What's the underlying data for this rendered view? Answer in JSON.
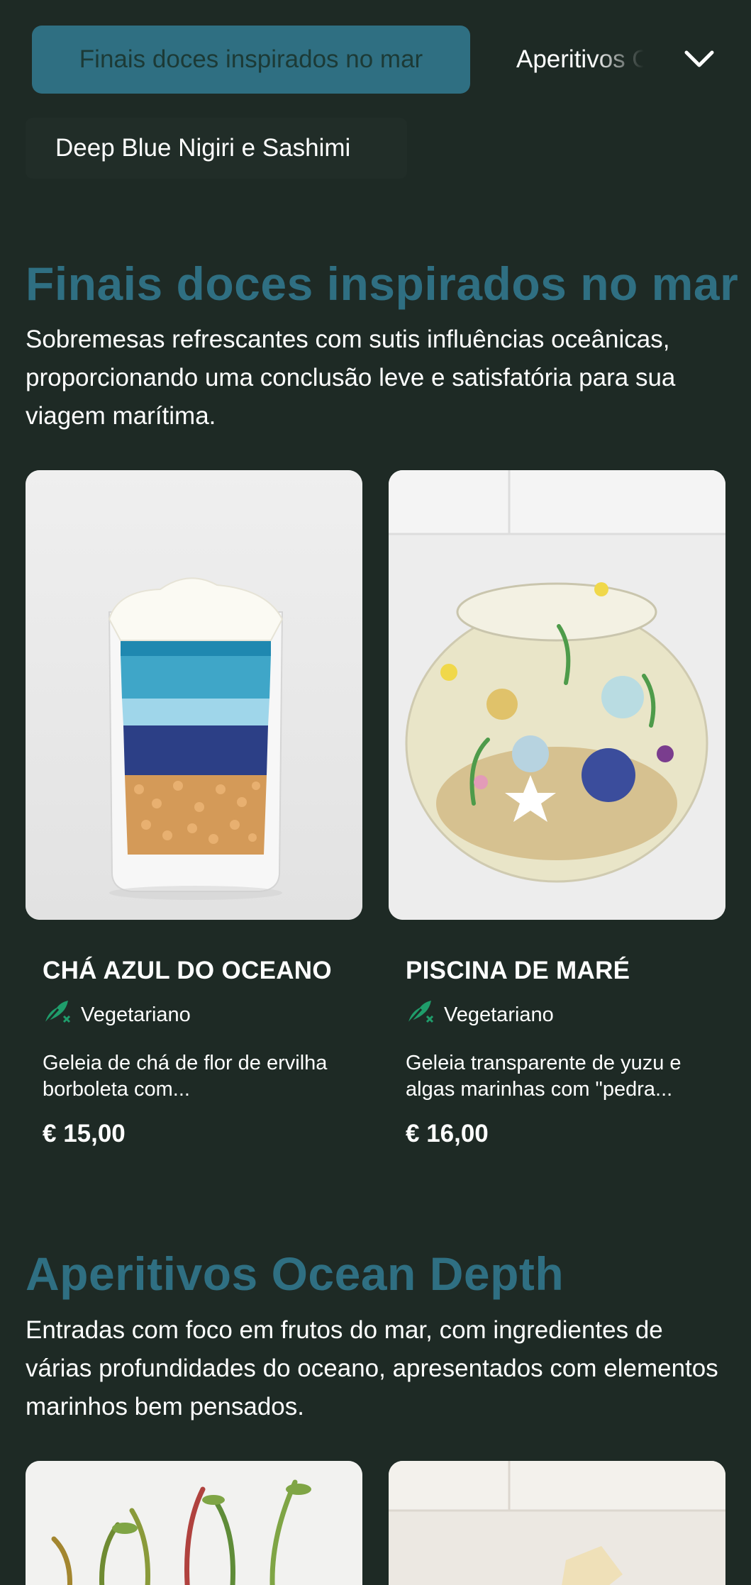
{
  "nav": {
    "active_category": "Finais doces inspirados no mar",
    "next_category": "Aperitivos Ocean Depth",
    "second_row_category": "Deep Blue Nigiri e Sashimi",
    "toggle_icon": "chevron-down-icon"
  },
  "sections": [
    {
      "title": "Finais doces inspirados no mar",
      "description": "Sobremesas refrescantes com sutis influências oceânicas, proporcionando uma conclusão leve e satisfatória para sua viagem marítima.",
      "items": [
        {
          "name": "CHÁ AZUL DO OCEANO",
          "diet_label": "Vegetariano",
          "description": "Geleia de chá de flor de ervilha borboleta com...",
          "price": "€ 15,00"
        },
        {
          "name": "PISCINA DE MARÉ",
          "diet_label": "Vegetariano",
          "description": "Geleia transparente de yuzu e algas marinhas com \"pedra...",
          "price": "€ 16,00"
        }
      ]
    },
    {
      "title": "Aperitivos Ocean Depth",
      "description": "Entradas com foco em frutos do mar, com ingredientes de várias profundidades do oceano, apresentados com elementos marinhos bem pensados."
    }
  ],
  "colors": {
    "background": "#1e2a25",
    "accent": "#2f6f82",
    "vegetarian_icon": "#1f9d6b"
  }
}
